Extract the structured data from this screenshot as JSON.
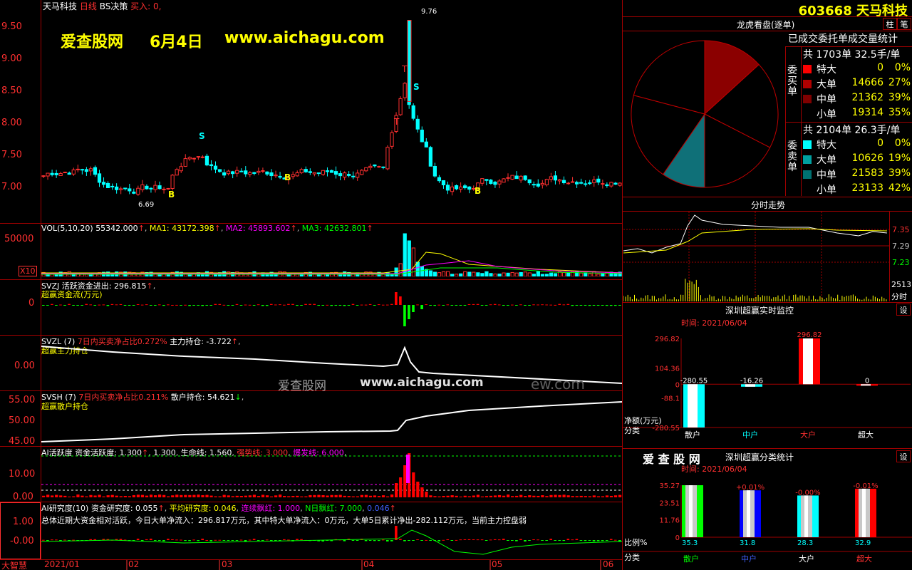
{
  "header": {
    "stock_name": "天马科技",
    "period": "日线",
    "strategy": "BS决策",
    "buy_label": "买入: 0,",
    "code_title": "603668 天马科技"
  },
  "watermark": {
    "site": "爱查股网",
    "date": "6月4日",
    "url": "www.aichagu.com",
    "mid_text": "爱查股网",
    "mid_url": "www.aichagu.com",
    "ghost": "ew.com"
  },
  "main_chart": {
    "y_ticks": [
      "9.50",
      "9.00",
      "8.50",
      "8.00",
      "7.50",
      "7.00"
    ],
    "high_label": "9.76",
    "low_label": "6.69",
    "markers": [
      "B",
      "S",
      "B",
      "S",
      "B",
      "T",
      "T"
    ]
  },
  "vol": {
    "title": "VOL(5,10,20)",
    "value": "55342.000",
    "ma1": "MA1: 43172.398",
    "ma2": "MA2: 45893.602",
    "ma3": "MA3: 42632.801",
    "y_tick": "50000",
    "unit": "X10"
  },
  "svzj": {
    "title": "SVZJ",
    "desc": "活跃资金进出: 296.815",
    "sub": "超赢资金流(万元)",
    "y_tick": "0"
  },
  "svzl": {
    "title": "SVZL (7)",
    "desc": "7日内买卖净占比0.272%",
    "extra": "主力持仓: -3.722",
    "sub": "超赢主力持仓",
    "y_tick": "0.00"
  },
  "svsh": {
    "title": "SVSH (7)",
    "desc": "7日内买卖净占比0.211%",
    "extra": "散户持仓: 54.621",
    "sub": "超赢散户持仓",
    "y_ticks": [
      "55.00",
      "50.00",
      "45.00"
    ]
  },
  "ai1": {
    "title": "AI活跃度",
    "a": "资金活跃度: 1.300",
    "b": "1.300",
    "c": "生命线: 1.560",
    "d": "强势线: 3.000",
    "e": "爆发线: 6.000",
    "y_ticks": [
      "10.00",
      "0.00"
    ]
  },
  "ai2": {
    "title": "AI研究度(10)",
    "a": "资金研究度: 0.055",
    "b": "平均研究度: 0.046",
    "c": "连续飘红: 1.000",
    "d": "N日飘红: 7.000",
    "e": "0.046",
    "summary": "总体近期大资金相对活跃，今日大单净流入：296.817万元，其中特大单净流入：0万元，大单5日累计净出-282.112万元，当前主力控盘弱",
    "y_ticks": [
      "1.00",
      "-0.00"
    ]
  },
  "bottom_axis": {
    "brand": "大智慧",
    "months": [
      "2021/01",
      "02",
      "03",
      "04",
      "05",
      "06"
    ]
  },
  "dragon_tiger": {
    "title": "龙虎看盘(逐单)",
    "btn1": "柱",
    "btn2": "笔",
    "stats_title": "已成交委托单成交量统计",
    "buy_group": "委买单",
    "sell_group": "委卖单",
    "buy_total": "共 1703单 32.5手/单",
    "sell_total": "共 2104单 26.3手/单",
    "buy_rows": [
      {
        "label": "特大",
        "count": "0",
        "pct": "0%",
        "color": "#ff0000"
      },
      {
        "label": "大单",
        "count": "14666",
        "pct": "27%",
        "color": "#b00000"
      },
      {
        "label": "中单",
        "count": "21362",
        "pct": "39%",
        "color": "#800000"
      },
      {
        "label": "小单",
        "count": "19314",
        "pct": "35%",
        "color": "#000000"
      }
    ],
    "sell_rows": [
      {
        "label": "特大",
        "count": "0",
        "pct": "0%",
        "color": "#00ffff"
      },
      {
        "label": "大单",
        "count": "10626",
        "pct": "19%",
        "color": "#00a0a0"
      },
      {
        "label": "中单",
        "count": "21583",
        "pct": "39%",
        "color": "#007070"
      },
      {
        "label": "小单",
        "count": "23133",
        "pct": "42%",
        "color": "#000000"
      }
    ]
  },
  "intraday": {
    "title": "分时走势",
    "prices": [
      "7.35",
      "7.29",
      "7.23"
    ],
    "vol": "2513",
    "vol_unit": "分时"
  },
  "realtime_monitor": {
    "title": "深圳超赢实时监控",
    "btn": "设",
    "time": "时间: 2021/06/04",
    "y_ticks": [
      "296.82",
      "104.36",
      "0",
      "-88.1",
      "-280.55"
    ],
    "y_unit": "净额(万元)",
    "x_unit": "分类",
    "categories": [
      "散户",
      "中户",
      "大户",
      "超大"
    ],
    "values": [
      "-280.55",
      "-16.26",
      "296.82",
      "0"
    ]
  },
  "class_stats": {
    "brand": "爱 查 股 网",
    "title": "深圳超赢分类统计",
    "btn": "设",
    "time": "时间: 2021/06/04",
    "y_ticks": [
      "35.27",
      "23.51",
      "11.76",
      "0"
    ],
    "y_unit": "比例%",
    "x_unit": "分类",
    "categories": [
      "散户",
      "中户",
      "大户",
      "超大"
    ],
    "changes": [
      "+0.01%",
      "-0.00%",
      "-0.01%"
    ],
    "values": [
      "35.3",
      "31.8",
      "28.3",
      "32.9"
    ]
  },
  "chart_data": [
    {
      "type": "pie",
      "title": "龙虎看盘(逐单)",
      "categories": [
        "委买大单",
        "委买中单",
        "委买小单",
        "委卖大单",
        "委卖中单",
        "委卖小单"
      ],
      "values": [
        14666,
        21362,
        19314,
        10626,
        21583,
        23133
      ]
    },
    {
      "type": "bar",
      "title": "深圳超赢实时监控",
      "categories": [
        "散户",
        "中户",
        "大户",
        "超大"
      ],
      "values": [
        -280.55,
        -16.26,
        296.82,
        0
      ],
      "ylabel": "净额(万元)",
      "ylim": [
        -280.55,
        296.82
      ]
    },
    {
      "type": "bar",
      "title": "深圳超赢分类统计",
      "categories": [
        "散户",
        "中户",
        "大户",
        "超大"
      ],
      "values": [
        35.3,
        31.8,
        28.3,
        32.9
      ],
      "ylabel": "比例%",
      "ylim": [
        0,
        35.27
      ]
    }
  ]
}
